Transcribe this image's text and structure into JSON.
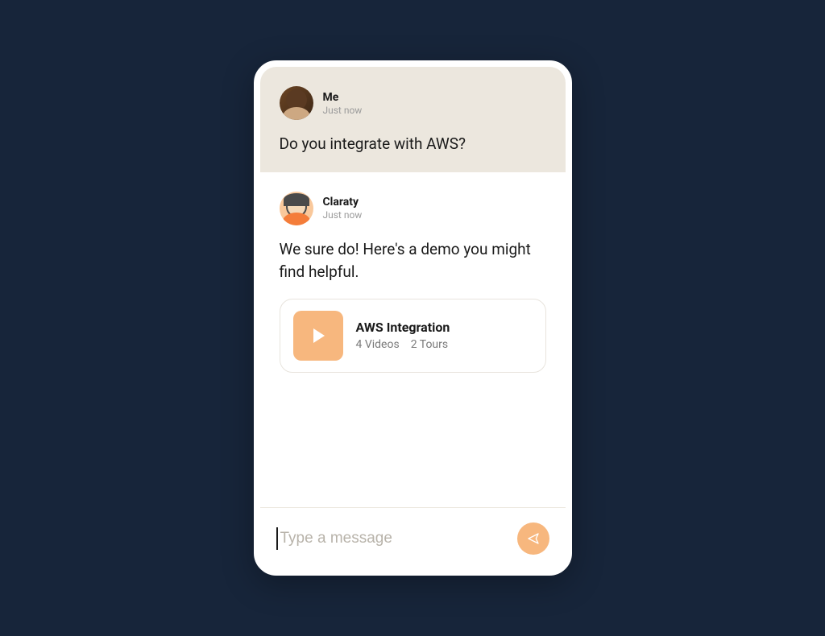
{
  "messages": {
    "user": {
      "name": "Me",
      "timestamp": "Just now",
      "text": "Do you integrate with AWS?"
    },
    "bot": {
      "name": "Claraty",
      "timestamp": "Just now",
      "text": "We sure do! Here's a demo you might find helpful."
    }
  },
  "demo_card": {
    "title": "AWS Integration",
    "videos_label": "4 Videos",
    "tours_label": "2 Tours"
  },
  "composer": {
    "placeholder": "Type a message"
  }
}
